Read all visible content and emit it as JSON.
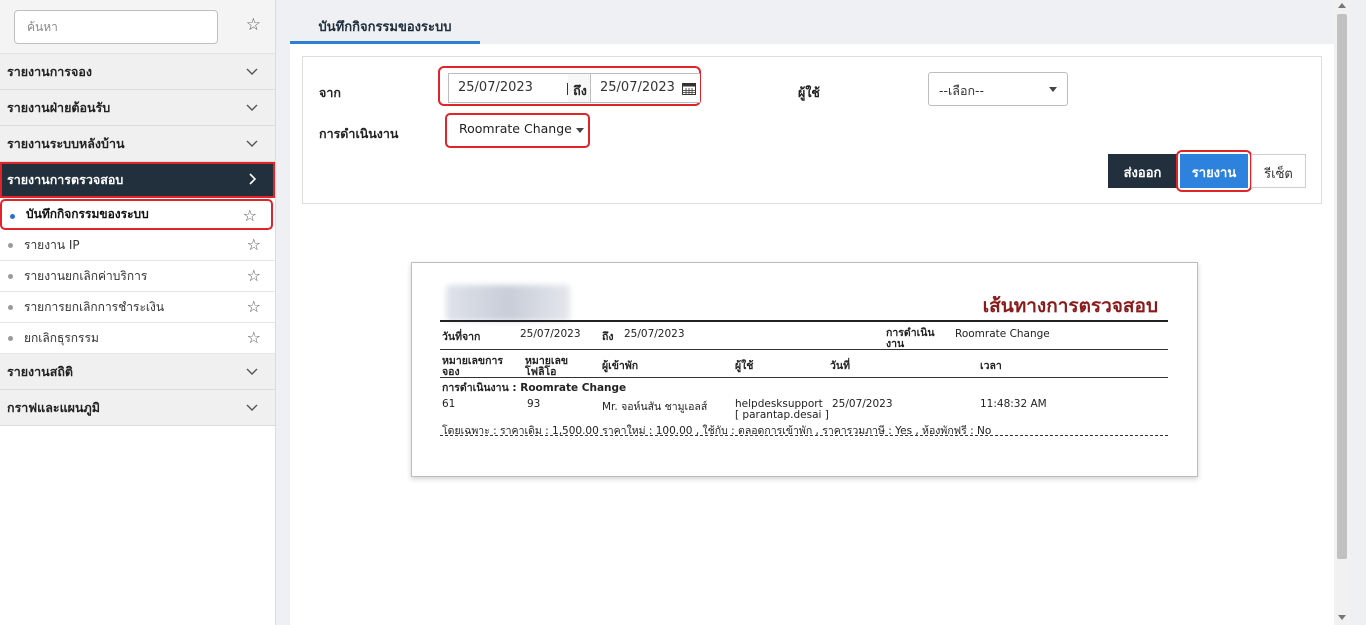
{
  "sidebar": {
    "search_placeholder": "ค้นหา",
    "sections": [
      {
        "label": "รายงานการจอง"
      },
      {
        "label": "รายงานฝ่ายต้อนรับ"
      },
      {
        "label": "รายงานระบบหลังบ้าน"
      },
      {
        "label": "รายงานการตรวจสอบ"
      },
      {
        "label": "รายงานสถิติ"
      },
      {
        "label": "กราฟและแผนภูมิ"
      }
    ],
    "audit_items": [
      {
        "label": "บันทึกกิจกรรมของระบบ"
      },
      {
        "label": "รายงาน IP"
      },
      {
        "label": "รายงานยกเลิกค่าบริการ"
      },
      {
        "label": "รายการยกเลิกการชำระเงิน"
      },
      {
        "label": "ยกเลิกธุรกรรม"
      }
    ]
  },
  "tab": {
    "label": "บันทึกกิจกรรมของระบบ"
  },
  "filter": {
    "from_label": "จาก",
    "from_date": "25/07/2023",
    "to_label": "ถึง",
    "to_date": "25/07/2023",
    "user_label": "ผู้ใช้",
    "user_value": "--เลือก--",
    "action_label": "การดำเนินงาน",
    "action_value": "Roomrate Change",
    "export_label": "ส่งออก",
    "report_label": "รายงาน",
    "reset_label": "รีเซ็ต"
  },
  "report": {
    "title": "เส้นทางการตรวจสอบ",
    "date_from_label": "วันที่จาก",
    "date_from": "25/07/2023",
    "to_label": "ถึง",
    "date_to": "25/07/2023",
    "action_label_line1": "การดำเนิน",
    "action_label_line2": "งาน",
    "action_value": "Roomrate Change",
    "headers": {
      "booking_no_1": "หมายเลขการ",
      "booking_no_2": "จอง",
      "folio_no_1": "หมายเลข",
      "folio_no_2": "โฟลิโอ",
      "guest": "ผู้เข้าพัก",
      "user": "ผู้ใช้",
      "date": "วันที่",
      "time": "เวลา"
    },
    "group_label": "การดำเนินงาน : Roomrate Change",
    "rows": [
      {
        "booking_no": "61",
        "folio_no": "93",
        "guest": "Mr. จอห์นสัน ชามูเอลส์",
        "user": "helpdesksupport",
        "user_sub": "[ parantap.desai ]",
        "date": "25/07/2023",
        "time": "11:48:32 AM",
        "detail": "โดยเฉพาะ : ราคาเดิม : 1,500.00 ราคาใหม่ : 100.00 , ใช้กับ : ตลอดการเข้าพัก , ราคารวมภาษี : Yes , ห้องพักฟรี : No"
      }
    ]
  },
  "colors": {
    "sidebar_active_bg": "#22303e",
    "highlight_border": "#e0242a",
    "primary_button": "#2c82dd",
    "tab_underline": "#2c7fd1",
    "report_title": "#8b1a1a"
  }
}
